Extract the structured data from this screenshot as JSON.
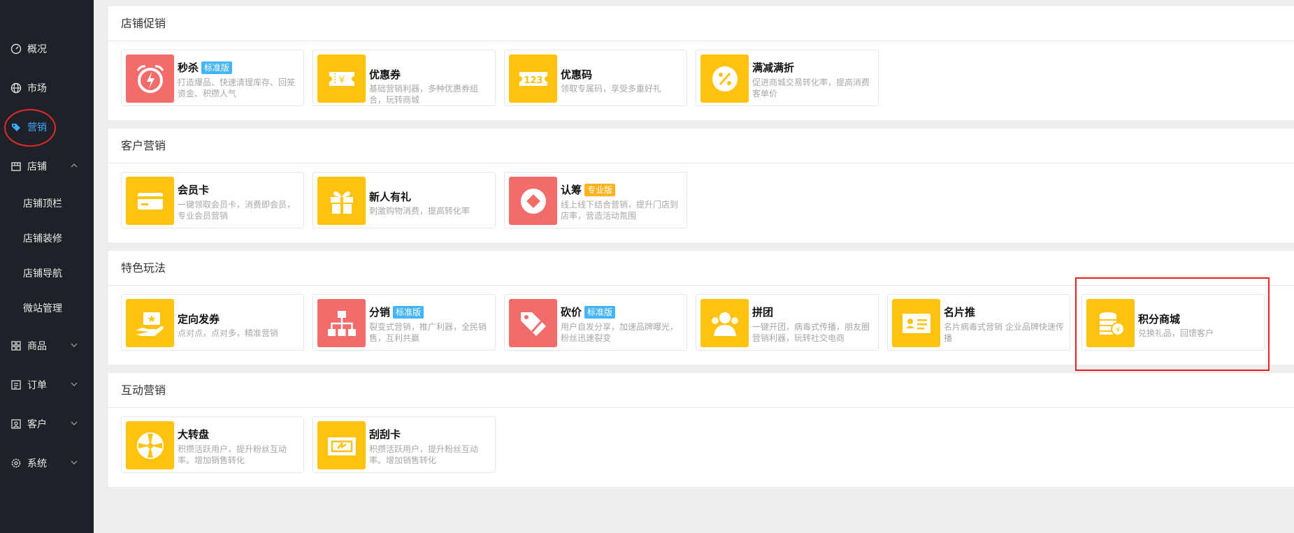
{
  "sidebar": {
    "items": [
      {
        "label": "概况",
        "icon": "dashboard-icon"
      },
      {
        "label": "市场",
        "icon": "globe-icon"
      },
      {
        "label": "营销",
        "icon": "tag-icon",
        "active": true
      },
      {
        "label": "店铺",
        "icon": "store-icon",
        "expanded": true
      },
      {
        "label": "商品",
        "icon": "grid-icon"
      },
      {
        "label": "订单",
        "icon": "list-icon"
      },
      {
        "label": "客户",
        "icon": "user-icon"
      },
      {
        "label": "系统",
        "icon": "gear-icon"
      }
    ],
    "store_sub_items": [
      "店铺顶栏",
      "店铺装修",
      "店铺导航",
      "微站管理"
    ]
  },
  "sections": [
    {
      "title": "店铺促销",
      "cards": [
        {
          "title": "秒杀",
          "badge": "标准版",
          "desc": "打造爆品、快速清理库存、回笼资金、积攒人气",
          "icon": "alarm-clock-icon",
          "color": "#f36c6c"
        },
        {
          "title": "优惠券",
          "desc": "基础营销利器，多种优惠券组合，玩转商城",
          "icon": "coupon-icon",
          "color": "#ffc30f"
        },
        {
          "title": "优惠码",
          "desc": "领取专属码，享受多重好礼",
          "icon": "code-ticket-icon",
          "color": "#ffc30f"
        },
        {
          "title": "满减满折",
          "desc": "促进商城交易转化率，提高消费客单价",
          "icon": "percent-icon",
          "color": "#ffc30f"
        }
      ]
    },
    {
      "title": "客户营销",
      "cards": [
        {
          "title": "会员卡",
          "desc": "一键领取会员卡，消费即会员，专业会员营销",
          "icon": "member-card-icon",
          "color": "#ffc30f"
        },
        {
          "title": "新人有礼",
          "desc": "刺激购物消费，提高转化率",
          "icon": "gift-icon",
          "color": "#ffc30f"
        },
        {
          "title": "认筹",
          "badge": "专业版",
          "desc": "线上线下结合营销，提升门店到店率，营造活动氛围",
          "icon": "diamond-circle-icon",
          "color": "#f36c6c"
        }
      ]
    },
    {
      "title": "特色玩法",
      "cards": [
        {
          "title": "定向发券",
          "desc": "点对点，点对多，精准营销",
          "icon": "hand-coupon-icon",
          "color": "#ffc30f"
        },
        {
          "title": "分销",
          "badge": "标准版",
          "desc": "裂变式营销，推广利器，全民销售，互利共赢",
          "icon": "hierarchy-icon",
          "color": "#f36c6c"
        },
        {
          "title": "砍价",
          "badge": "标准版",
          "desc": "用户自发分享，加速品牌曝光，粉丝迅速裂变",
          "icon": "price-tag-cut-icon",
          "color": "#f36c6c"
        },
        {
          "title": "拼团",
          "desc": "一键开团，病毒式传播，朋友圈营销利器，玩转社交电商",
          "icon": "group-users-icon",
          "color": "#ffc30f"
        },
        {
          "title": "名片推",
          "desc": "名片病毒式营销 企业品牌快速传播",
          "icon": "business-card-icon",
          "color": "#ffc30f"
        },
        {
          "title": "积分商城",
          "desc": "兑换礼品，回馈客户",
          "icon": "coins-icon",
          "color": "#ffc30f"
        }
      ]
    },
    {
      "title": "互动营销",
      "cards": [
        {
          "title": "大转盘",
          "desc": "积攒活跃用户，提升粉丝互动率。增加销售转化",
          "icon": "wheel-icon",
          "color": "#ffc30f"
        },
        {
          "title": "刮刮卡",
          "desc": "积攒活跃用户，提升粉丝互动率。增加销售转化",
          "icon": "scratch-card-icon",
          "color": "#ffc30f"
        }
      ]
    }
  ]
}
